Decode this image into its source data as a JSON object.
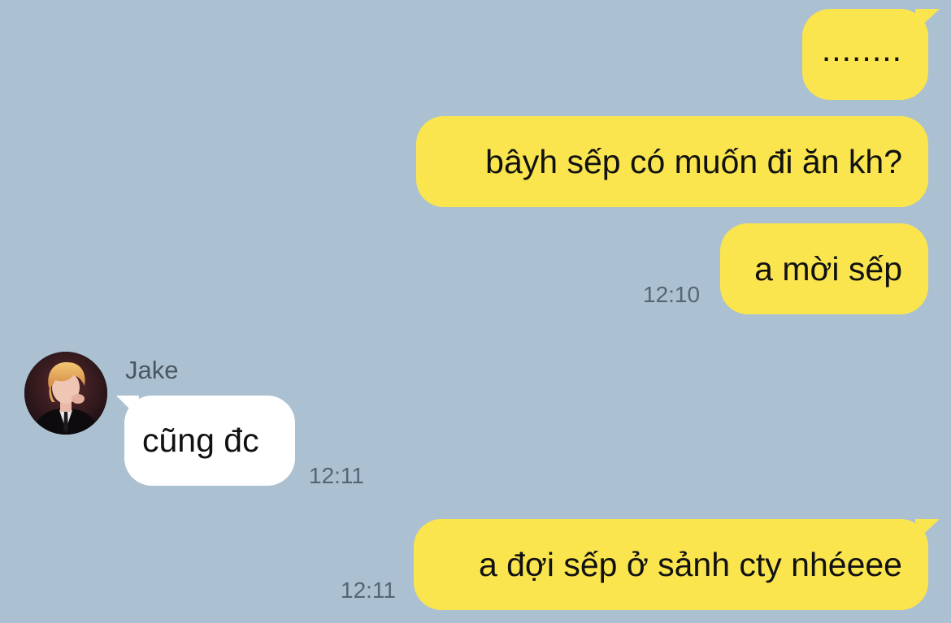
{
  "chat": {
    "messages": [
      {
        "id": "m1",
        "direction": "outgoing",
        "text": "........",
        "time": ""
      },
      {
        "id": "m2",
        "direction": "outgoing",
        "text": "bâyh sếp có muốn đi ăn kh?",
        "time": ""
      },
      {
        "id": "m3",
        "direction": "outgoing",
        "text": "a mời sếp",
        "time": "12:10"
      },
      {
        "id": "m4",
        "direction": "incoming",
        "sender": "Jake",
        "text": "cũng đc",
        "time": "12:11"
      },
      {
        "id": "m5",
        "direction": "outgoing",
        "text": "a đợi sếp ở sảnh cty nhéeee",
        "time": "12:11"
      }
    ]
  },
  "colors": {
    "background": "#abc1d1",
    "outgoing_bubble": "#fae54f",
    "incoming_bubble": "#ffffff",
    "timestamp": "#566574"
  },
  "icons": {
    "avatar": "profile-photo-avatar"
  }
}
